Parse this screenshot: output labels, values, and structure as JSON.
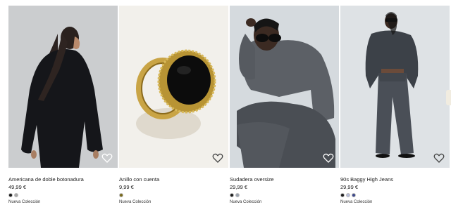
{
  "products": [
    {
      "name": "Americana de doble botonadura",
      "price": "49,99 €",
      "swatches": [
        "#1b1b1b",
        "#a8a8a8"
      ],
      "tag": "Nueva Colección",
      "bg": "#c9cccd"
    },
    {
      "name": "Anillo con cuenta",
      "price": "9,99 €",
      "swatches": [
        "#7a6a1e"
      ],
      "tag": "Nueva Colección",
      "bg": "#f3f1ec"
    },
    {
      "name": "Sudadera oversize",
      "price": "29,99 €",
      "swatches": [
        "#1e1e1e",
        "#9aa3ae"
      ],
      "tag": "Nueva Colección",
      "bg": "#d3d9de"
    },
    {
      "name": "90s Baggy High Jeans",
      "price": "29,99 €",
      "swatches": [
        "#1e1e1e",
        "#b6bcd9",
        "#3e4a8c"
      ],
      "tag": "Nueva Colección",
      "bg": "#dfe3e6"
    }
  ],
  "colors": {
    "favorite_icon": "#ffffff"
  }
}
